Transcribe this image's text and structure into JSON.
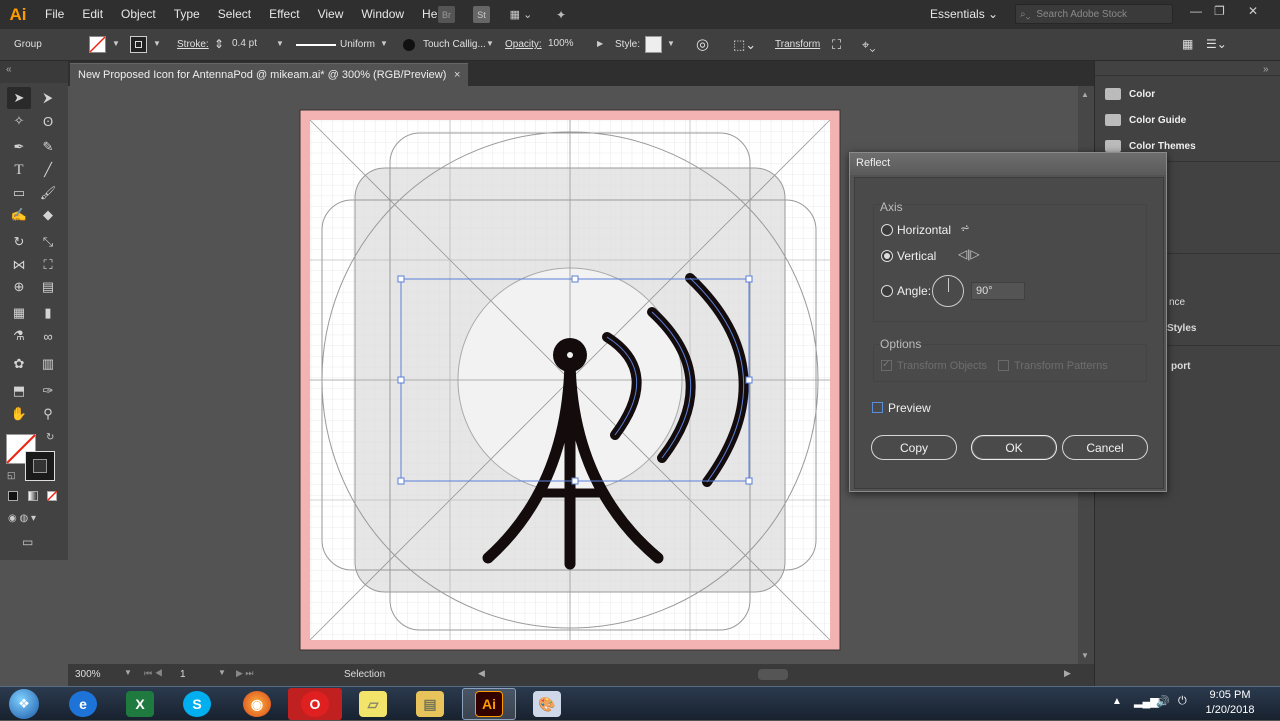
{
  "menubar": {
    "logo": "Ai",
    "items": [
      "File",
      "Edit",
      "Object",
      "Type",
      "Select",
      "Effect",
      "View",
      "Window",
      "Help"
    ],
    "bridge_label": "Br",
    "stock_label": "St",
    "workspace": "Essentials",
    "search_placeholder": "Search Adobe Stock"
  },
  "control": {
    "selection_label": "Group",
    "stroke_label": "Stroke:",
    "stroke_value": "0.4 pt",
    "profile_value": "Uniform",
    "brush_value": "Touch Callig...",
    "opacity_label": "Opacity:",
    "opacity_value": "100%",
    "style_label": "Style:",
    "transform_label": "Transform"
  },
  "document": {
    "tab_title": "New Proposed Icon for AntennaPod @ mikeam.ai* @ 300% (RGB/Preview)",
    "close": "×"
  },
  "status": {
    "zoom": "300%",
    "artboard": "1",
    "tool": "Selection"
  },
  "panels": {
    "items": [
      "Color",
      "Color Guide",
      "Color Themes"
    ],
    "partials": [
      "nce",
      "Styles",
      "port"
    ]
  },
  "dialog": {
    "title": "Reflect",
    "axis_label": "Axis",
    "horizontal_label": "Horizontal",
    "vertical_label": "Vertical",
    "angle_label": "Angle:",
    "angle_value": "90°",
    "options_label": "Options",
    "transform_objects": "Transform Objects",
    "transform_patterns": "Transform Patterns",
    "preview_label": "Preview",
    "copy_label": "Copy",
    "ok_label": "OK",
    "cancel_label": "Cancel",
    "selected_axis": "Vertical"
  },
  "taskbar": {
    "time": "9:05 PM",
    "date": "1/20/2018",
    "apps": [
      "start",
      "internet-explorer",
      "excel",
      "skype",
      "firefox",
      "opera",
      "sticky-notes",
      "file-explorer",
      "illustrator",
      "paint"
    ]
  },
  "colors": {
    "artboard_bleed": "#f4b3b3",
    "accent_blue": "#5a7fd8",
    "illustrator_orange": "#ff9a00",
    "antenna": "#140c0c"
  }
}
